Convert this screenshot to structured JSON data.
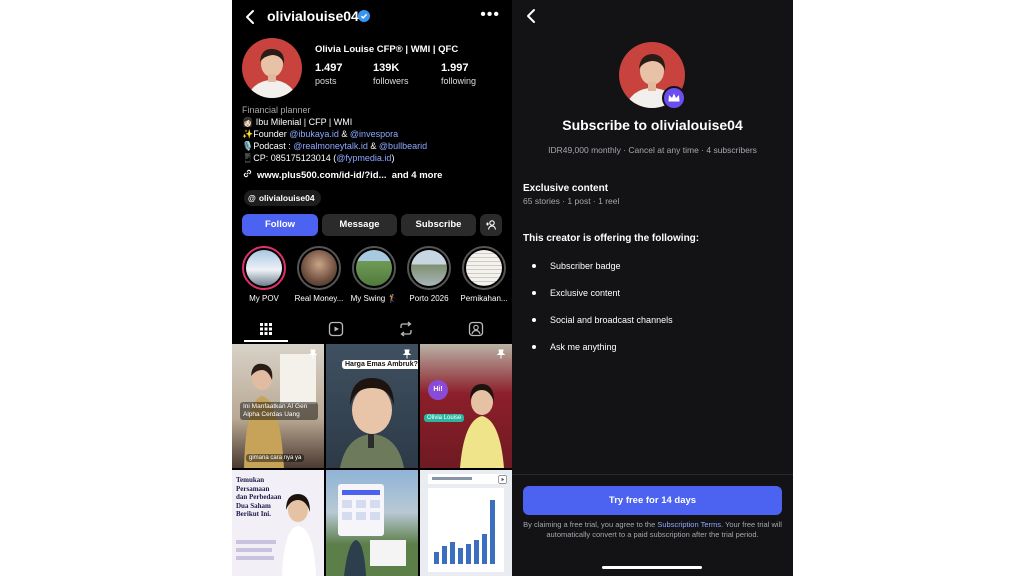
{
  "profile": {
    "username": "olivialouise04",
    "full_name": "Olivia Louise CFP® | WMI | QFC",
    "stats": [
      {
        "value": "1.497",
        "label": "posts"
      },
      {
        "value": "139K",
        "label": "followers"
      },
      {
        "value": "1.997",
        "label": "following"
      }
    ],
    "bio": {
      "category": "Financial planner",
      "line1": "👩🏻 Ibu Milenial | CFP | WMI",
      "line2_prefix": "✨Founder ",
      "line2_link1": "@ibukaya.id",
      "line2_mid": " & ",
      "line2_link2": "@invespora",
      "line3_prefix": "🎙️Podcast : ",
      "line3_link1": "@realmoneytalk.id",
      "line3_mid": " & ",
      "line3_link2": "@bullbearid",
      "line4_prefix": "📱CP: 085175123014 (",
      "line4_link": "@fypmedia.id",
      "line4_suffix": ")"
    },
    "website": "www.plus500.com/id-id/?id...",
    "website_more": "and 4 more",
    "threads_handle": "olivialouise04",
    "buttons": {
      "follow": "Follow",
      "message": "Message",
      "subscribe": "Subscribe"
    },
    "highlights": [
      {
        "label": "My POV",
        "color": "#6b8fb8"
      },
      {
        "label": "Real Money...",
        "color": "#8a6a58"
      },
      {
        "label": "My Swing 🏌️",
        "color": "#5e8a4e"
      },
      {
        "label": "Porto 2026",
        "color": "#9aa7b0"
      },
      {
        "label": "Pernikahan...",
        "color": "#d8d4cc"
      }
    ],
    "grid_captions": {
      "post1": "Ini Manfaatkan AI Gen Alpha Cerdas Uang",
      "post1_sub": "gimana cara nya ya",
      "post2": "Harga Emas Ambruk?",
      "post3_badge": "Hi!",
      "post3_tag": "Olivia Louise",
      "post4": "Temukan Persamaan dan Perbedaan Dua Saham Berikut Ini."
    }
  },
  "subscribe": {
    "title": "Subscribe to olivialouise04",
    "meta": "IDR49,000 monthly · Cancel at any time · 4 subscribers",
    "exclusive_title": "Exclusive content",
    "exclusive_meta": "65 stories · 1 post · 1 reel",
    "offer_title": "This creator is offering the following:",
    "offers": [
      "Subscriber badge",
      "Exclusive content",
      "Social and broadcast channels",
      "Ask me anything"
    ],
    "cta": "Try free for 14 days",
    "terms_prefix": "By claiming a free trial, you agree to the ",
    "terms_link": "Subscription Terms",
    "terms_suffix": ". Your free trial will automatically convert to a paid subscription after the trial period."
  },
  "colors": {
    "accent": "#4c62f0",
    "link": "#8ea8ff",
    "verified": "#3797f0",
    "crown": "#6b4ef0"
  }
}
